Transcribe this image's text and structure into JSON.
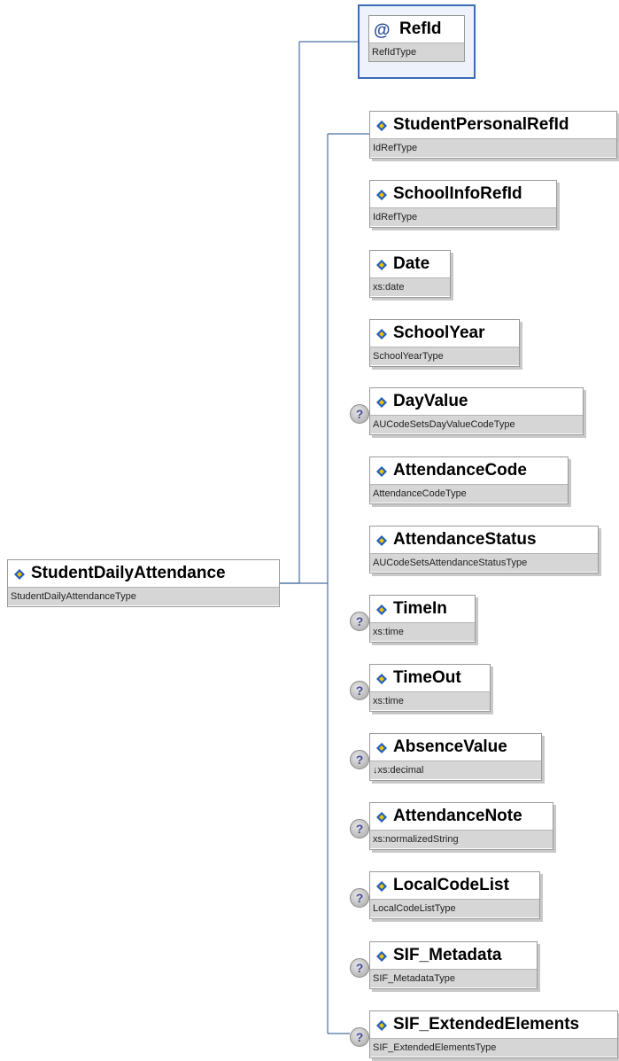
{
  "root": {
    "name": "StudentDailyAttendance",
    "type": "StudentDailyAttendanceType"
  },
  "attribute": {
    "marker": "@",
    "name": "RefId",
    "type": "RefIdType"
  },
  "elements": [
    {
      "name": "StudentPersonalRefId",
      "type": "IdRefType",
      "optional": false
    },
    {
      "name": "SchoolInfoRefId",
      "type": "IdRefType",
      "optional": false
    },
    {
      "name": "Date",
      "type": "xs:date",
      "optional": false
    },
    {
      "name": "SchoolYear",
      "type": "SchoolYearType",
      "optional": false
    },
    {
      "name": "DayValue",
      "type": "AUCodeSetsDayValueCodeType",
      "optional": true
    },
    {
      "name": "AttendanceCode",
      "type": "AttendanceCodeType",
      "optional": false
    },
    {
      "name": "AttendanceStatus",
      "type": "AUCodeSetsAttendanceStatusType",
      "optional": false
    },
    {
      "name": "TimeIn",
      "type": "xs:time",
      "optional": true
    },
    {
      "name": "TimeOut",
      "type": "xs:time",
      "optional": true
    },
    {
      "name": "AbsenceValue",
      "type": "↓xs:decimal",
      "optional": true
    },
    {
      "name": "AttendanceNote",
      "type": "xs:normalizedString",
      "optional": true
    },
    {
      "name": "LocalCodeList",
      "type": "LocalCodeListType",
      "optional": true
    },
    {
      "name": "SIF_Metadata",
      "type": "SIF_MetadataType",
      "optional": true
    },
    {
      "name": "SIF_ExtendedElements",
      "type": "SIF_ExtendedElementsType",
      "optional": true
    }
  ],
  "optional_marker": "?",
  "colors": {
    "connector": "#4a6fa5",
    "diamond_blue": "#1f5fbf",
    "diamond_yellow": "#f2c200"
  }
}
